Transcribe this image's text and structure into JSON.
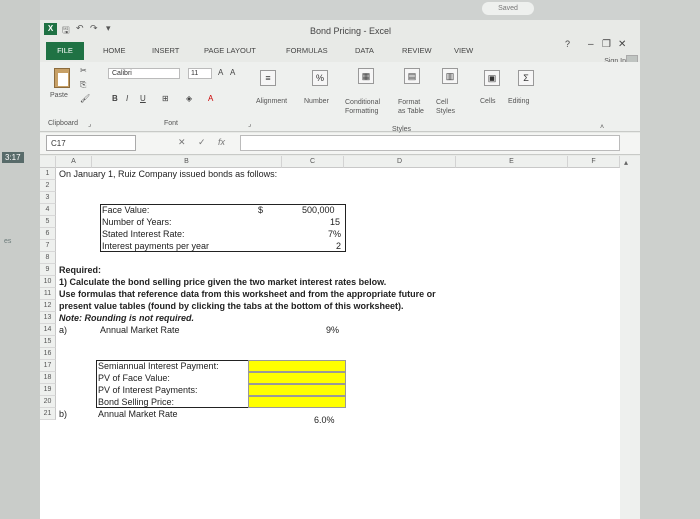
{
  "saved_label": "Saved",
  "left_strip": {
    "time_tag": "3:17",
    "fragment": "es"
  },
  "window": {
    "title": "Bond Pricing - Excel",
    "help": "?",
    "minimize": "–",
    "restore": "❐",
    "close": "✕",
    "sign_in": "Sign In"
  },
  "tabs": [
    "FILE",
    "HOME",
    "INSERT",
    "PAGE LAYOUT",
    "FORMULAS",
    "DATA",
    "REVIEW",
    "VIEW"
  ],
  "ribbon": {
    "paste": "Paste",
    "clipboard": "Clipboard",
    "font_name": "Calibri",
    "font_size": "11",
    "font_group": "Font",
    "bold": "B",
    "italic": "I",
    "underline": "U",
    "alignment": "Alignment",
    "number": "Number",
    "percent": "%",
    "conditional_formatting": "Conditional Formatting",
    "format_as_table": "Format as Table",
    "cell_styles": "Cell Styles",
    "styles": "Styles",
    "cells": "Cells",
    "editing": "Editing"
  },
  "formula_bar": {
    "name_box": "C17",
    "fx": "fx",
    "value": ""
  },
  "columns": [
    "A",
    "B",
    "C",
    "D",
    "E",
    "F"
  ],
  "rows": [
    "1",
    "2",
    "3",
    "4",
    "5",
    "6",
    "7",
    "8",
    "9",
    "10",
    "11",
    "12",
    "13",
    "14",
    "15",
    "16",
    "17",
    "18",
    "19",
    "20",
    "21"
  ],
  "sheet": {
    "r1": "On January 1, Ruiz Company issued bonds as follows:",
    "face_value_label": "Face Value:",
    "face_value_currency": "$",
    "face_value": "500,000",
    "years_label": "Number of Years:",
    "years": "15",
    "rate_label": "Stated Interest Rate:",
    "rate": "7%",
    "payments_label": "Interest payments per year",
    "payments": "2",
    "required": "Required:",
    "r10": "1) Calculate the bond selling price given the two market interest rates below.",
    "r11": "Use formulas that reference data from this worksheet and from the appropriate future or",
    "r12": "present value tables (found by clicking the tabs at the bottom of this worksheet).",
    "r13": "Note: Rounding is not required.",
    "a_label": "a)",
    "a_market_label": "Annual Market Rate",
    "a_market_rate": "9%",
    "semi_label": "Semiannual Interest Payment:",
    "pv_face_label": "PV of Face Value:",
    "pv_int_label": "PV of Interest Payments:",
    "selling_label": "Bond Selling Price:",
    "b_label": "b)",
    "b_market_label": "Annual Market Rate",
    "b_market_rate": "6.0%"
  }
}
